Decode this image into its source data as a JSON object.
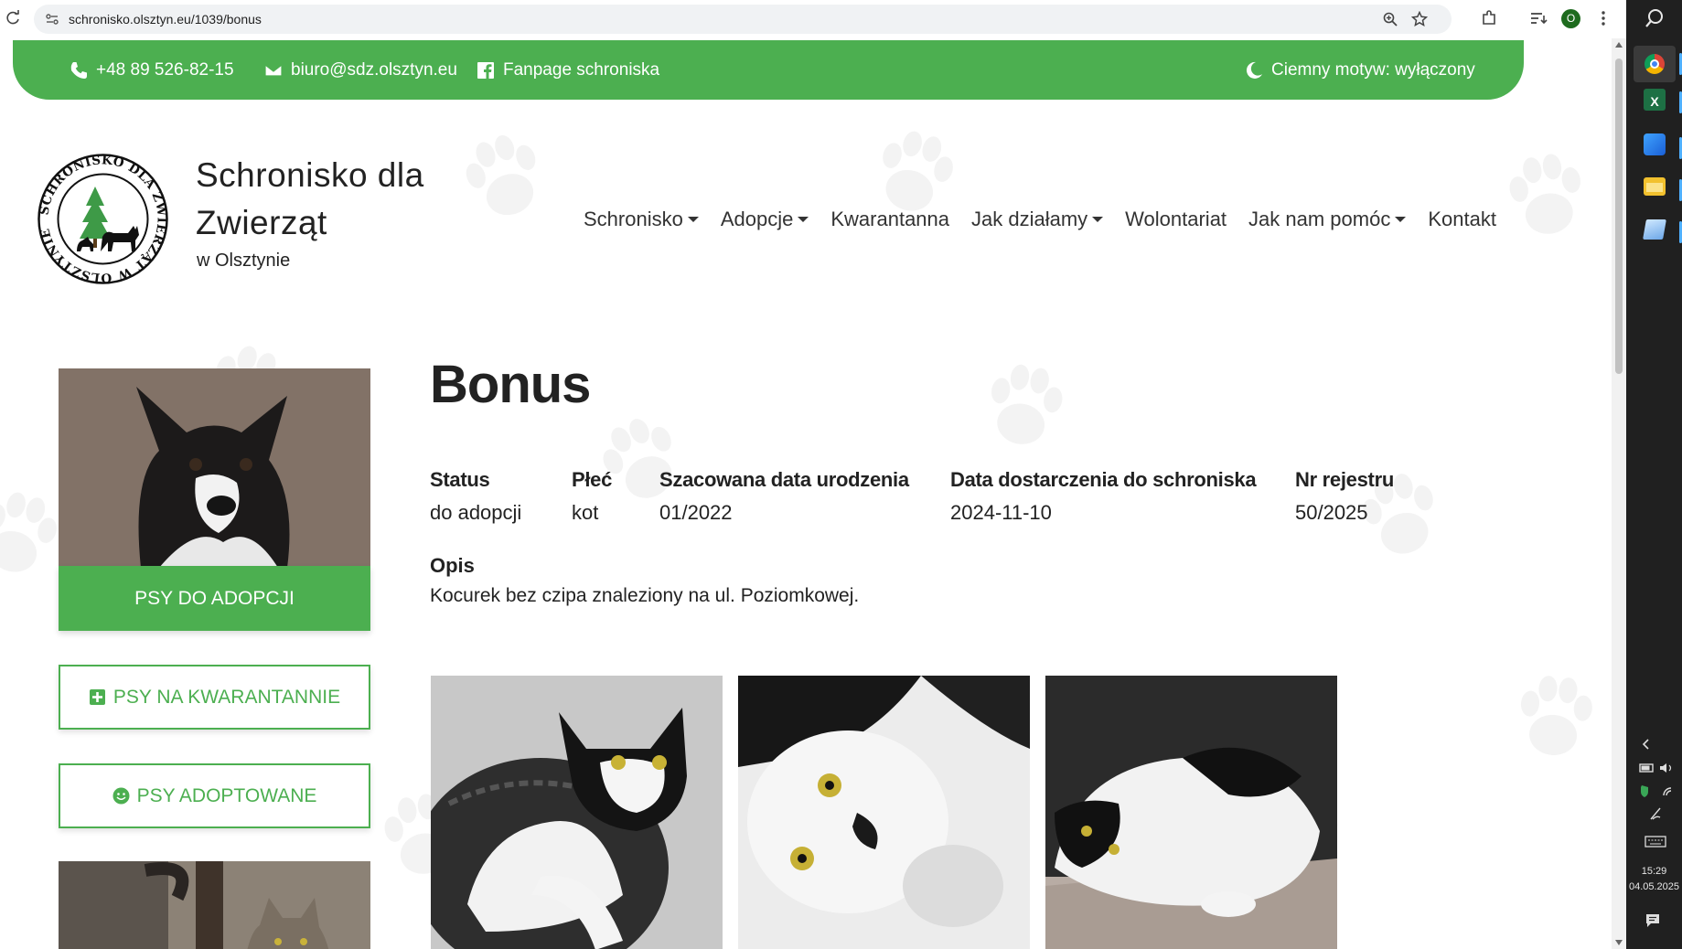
{
  "browser": {
    "url": "schronisko.olsztyn.eu/1039/bonus",
    "profile_initial": "O"
  },
  "taskbar": {
    "time": "15:29",
    "date": "04.05.2025"
  },
  "topbar": {
    "phone": "+48 89 526-82-15",
    "email": "biuro@sdz.olsztyn.eu",
    "fanpage": "Fanpage schroniska",
    "dark_mode": "Ciemny motyw: wyłączony"
  },
  "brand": {
    "title": "Schronisko dla Zwierząt",
    "subtitle": "w Olsztynie",
    "logo_text": "SCHRONISKO DLA ZWIERZĄT W OLSZTYNIE"
  },
  "nav": {
    "items": [
      {
        "label": "Schronisko",
        "dropdown": true
      },
      {
        "label": "Adopcje",
        "dropdown": true
      },
      {
        "label": "Kwarantanna",
        "dropdown": false
      },
      {
        "label": "Jak działamy",
        "dropdown": true
      },
      {
        "label": "Wolontariat",
        "dropdown": false
      },
      {
        "label": "Jak nam pomóc",
        "dropdown": true
      },
      {
        "label": "Kontakt",
        "dropdown": false
      }
    ]
  },
  "sidebar": {
    "dogs_adoption": "PSY DO ADOPCJI",
    "dogs_quarantine": "PSY NA KWARANTANNIE",
    "dogs_adopted": "PSY ADOPTOWANE"
  },
  "animal": {
    "name": "Bonus",
    "fields": [
      {
        "label": "Status",
        "value": "do adopcji"
      },
      {
        "label": "Płeć",
        "value": "kot"
      },
      {
        "label": "Szacowana data urodzenia",
        "value": "01/2022"
      },
      {
        "label": "Data dostarczenia do schroniska",
        "value": "2024-11-10"
      },
      {
        "label": "Nr rejestru",
        "value": "50/2025"
      }
    ],
    "description_label": "Opis",
    "description": "Kocurek bez czipa znaleziony na ul. Poziomkowej."
  },
  "colors": {
    "brand_green": "#4caf50"
  }
}
